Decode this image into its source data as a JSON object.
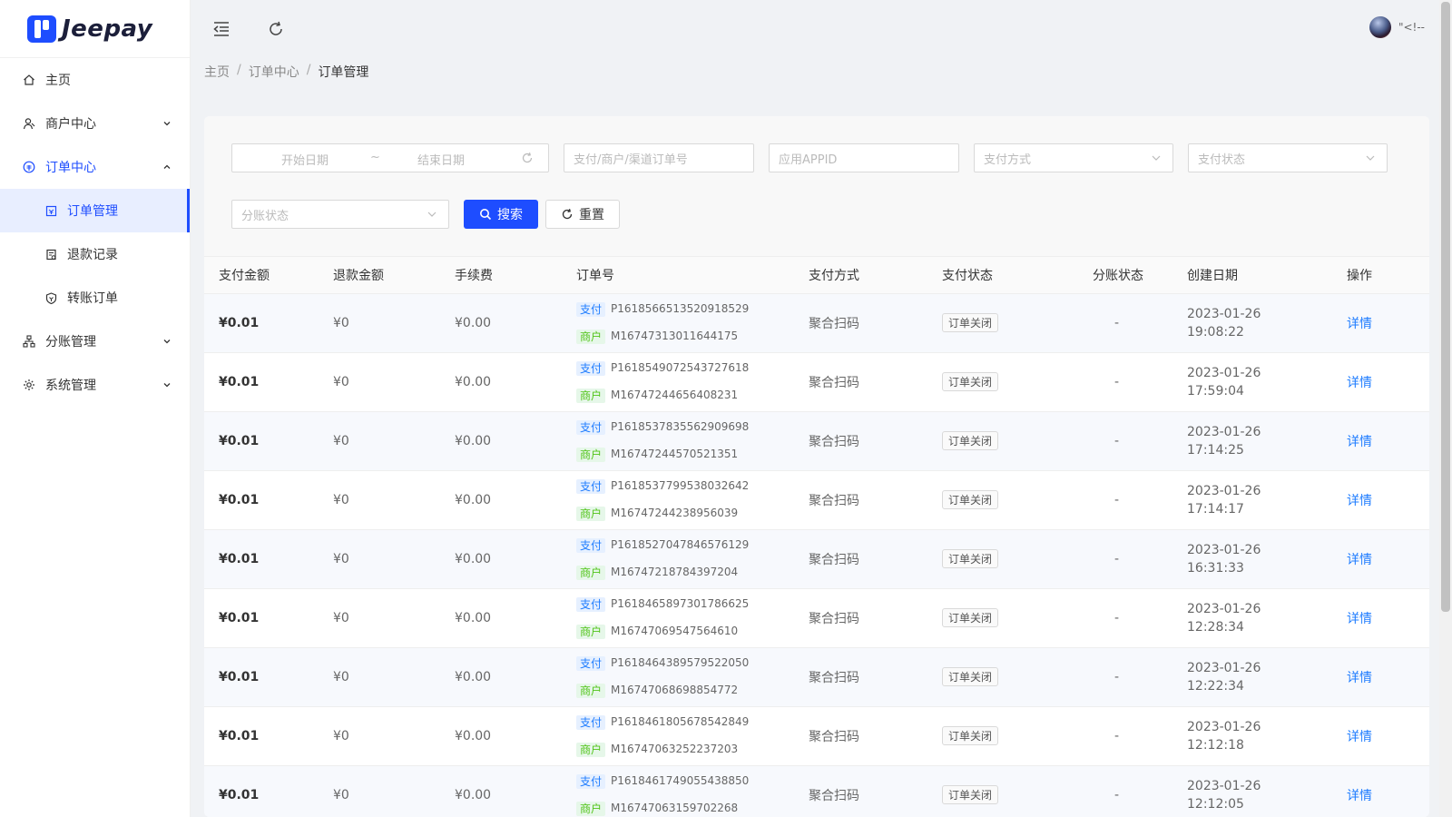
{
  "brand": {
    "name": "Jeepay"
  },
  "sidebar": {
    "items": [
      {
        "label": "主页",
        "icon": "home-icon",
        "expandable": false
      },
      {
        "label": "商户中心",
        "icon": "user-icon",
        "expandable": true
      },
      {
        "label": "订单中心",
        "icon": "order-center-icon",
        "expandable": true,
        "open": true,
        "children": [
          {
            "label": "订单管理",
            "icon": "order-manage-icon",
            "active": true
          },
          {
            "label": "退款记录",
            "icon": "refund-icon"
          },
          {
            "label": "转账订单",
            "icon": "transfer-icon"
          }
        ]
      },
      {
        "label": "分账管理",
        "icon": "split-icon",
        "expandable": true
      },
      {
        "label": "系统管理",
        "icon": "gear-icon",
        "expandable": true
      }
    ]
  },
  "header": {
    "user_name": "\"<!--"
  },
  "breadcrumb": [
    "主页",
    "订单中心",
    "订单管理"
  ],
  "filters": {
    "start_date_placeholder": "开始日期",
    "range_sep": "~",
    "end_date_placeholder": "结束日期",
    "order_no_placeholder": "支付/商户/渠道订单号",
    "appid_placeholder": "应用APPID",
    "pay_type_placeholder": "支付方式",
    "pay_state_placeholder": "支付状态",
    "split_state_placeholder": "分账状态",
    "search_label": "搜索",
    "reset_label": "重置"
  },
  "table": {
    "columns": [
      "支付金额",
      "退款金额",
      "手续费",
      "订单号",
      "支付方式",
      "支付状态",
      "分账状态",
      "创建日期",
      "操作"
    ],
    "pay_tag": "支付",
    "mch_tag": "商户",
    "detail_label": "详情",
    "rows": [
      {
        "amount": "¥0.01",
        "refund": "¥0",
        "fee": "¥0.00",
        "pay_no": "P1618566513520918529",
        "mch_no": "M16747313011644175",
        "way": "聚合扫码",
        "state": "订单关闭",
        "split": "-",
        "date": "2023-01-26",
        "time": "19:08:22"
      },
      {
        "amount": "¥0.01",
        "refund": "¥0",
        "fee": "¥0.00",
        "pay_no": "P1618549072543727618",
        "mch_no": "M16747244656408231",
        "way": "聚合扫码",
        "state": "订单关闭",
        "split": "-",
        "date": "2023-01-26",
        "time": "17:59:04"
      },
      {
        "amount": "¥0.01",
        "refund": "¥0",
        "fee": "¥0.00",
        "pay_no": "P1618537835562909698",
        "mch_no": "M16747244570521351",
        "way": "聚合扫码",
        "state": "订单关闭",
        "split": "-",
        "date": "2023-01-26",
        "time": "17:14:25"
      },
      {
        "amount": "¥0.01",
        "refund": "¥0",
        "fee": "¥0.00",
        "pay_no": "P1618537799538032642",
        "mch_no": "M16747244238956039",
        "way": "聚合扫码",
        "state": "订单关闭",
        "split": "-",
        "date": "2023-01-26",
        "time": "17:14:17"
      },
      {
        "amount": "¥0.01",
        "refund": "¥0",
        "fee": "¥0.00",
        "pay_no": "P1618527047846576129",
        "mch_no": "M16747218784397204",
        "way": "聚合扫码",
        "state": "订单关闭",
        "split": "-",
        "date": "2023-01-26",
        "time": "16:31:33"
      },
      {
        "amount": "¥0.01",
        "refund": "¥0",
        "fee": "¥0.00",
        "pay_no": "P1618465897301786625",
        "mch_no": "M16747069547564610",
        "way": "聚合扫码",
        "state": "订单关闭",
        "split": "-",
        "date": "2023-01-26",
        "time": "12:28:34"
      },
      {
        "amount": "¥0.01",
        "refund": "¥0",
        "fee": "¥0.00",
        "pay_no": "P1618464389579522050",
        "mch_no": "M16747068698854772",
        "way": "聚合扫码",
        "state": "订单关闭",
        "split": "-",
        "date": "2023-01-26",
        "time": "12:22:34"
      },
      {
        "amount": "¥0.01",
        "refund": "¥0",
        "fee": "¥0.00",
        "pay_no": "P1618461805678542849",
        "mch_no": "M16747063252237203",
        "way": "聚合扫码",
        "state": "订单关闭",
        "split": "-",
        "date": "2023-01-26",
        "time": "12:12:18"
      },
      {
        "amount": "¥0.01",
        "refund": "¥0",
        "fee": "¥0.00",
        "pay_no": "P1618461749055438850",
        "mch_no": "M16747063159702268",
        "way": "聚合扫码",
        "state": "订单关闭",
        "split": "-",
        "date": "2023-01-26",
        "time": "12:12:05"
      }
    ]
  },
  "colors": {
    "accent": "#1e4dff",
    "link": "#1e7cff",
    "pay_tag": "#1e7cff",
    "mch_tag": "#52c41a"
  }
}
